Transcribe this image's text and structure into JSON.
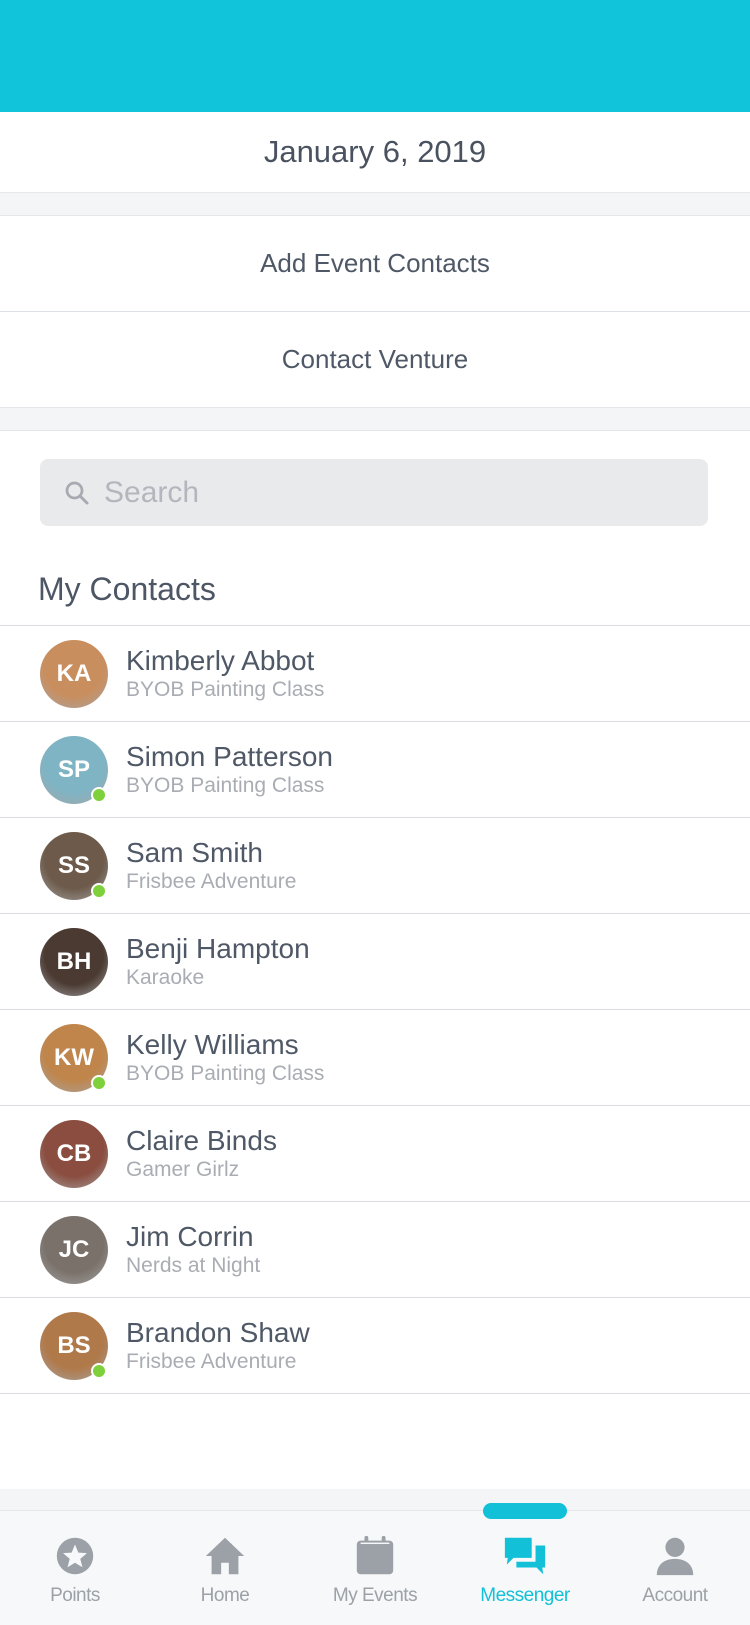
{
  "colors": {
    "brand": "#11c4da",
    "online": "#7fd13b",
    "tab_inactive": "#9ca1a8"
  },
  "header": {
    "date": "January 6, 2019"
  },
  "actions": [
    {
      "label": "Add Event Contacts"
    },
    {
      "label": "Contact Venture"
    }
  ],
  "search": {
    "placeholder": "Search",
    "value": ""
  },
  "contacts_section": {
    "title": "My Contacts"
  },
  "contacts": [
    {
      "name": "Kimberly Abbot",
      "event": "BYOB Painting Class",
      "initials": "KA",
      "online": false,
      "avatar_color": "#c98e5e"
    },
    {
      "name": "Simon Patterson",
      "event": "BYOB Painting Class",
      "initials": "SP",
      "online": true,
      "avatar_color": "#7fb4c4"
    },
    {
      "name": "Sam Smith",
      "event": "Frisbee Adventure",
      "initials": "SS",
      "online": true,
      "avatar_color": "#6d5a4a"
    },
    {
      "name": "Benji Hampton",
      "event": "Karaoke",
      "initials": "BH",
      "online": false,
      "avatar_color": "#4a3a32"
    },
    {
      "name": "Kelly Williams",
      "event": "BYOB Painting Class",
      "initials": "KW",
      "online": true,
      "avatar_color": "#c0854b"
    },
    {
      "name": "Claire Binds",
      "event": "Gamer Girlz",
      "initials": "CB",
      "online": false,
      "avatar_color": "#8a4d3f"
    },
    {
      "name": "Jim Corrin",
      "event": "Nerds at Night",
      "initials": "JC",
      "online": false,
      "avatar_color": "#7a716a"
    },
    {
      "name": "Brandon Shaw",
      "event": "Frisbee Adventure",
      "initials": "BS",
      "online": true,
      "avatar_color": "#b0794a"
    }
  ],
  "tabbar": {
    "active": "Messenger",
    "tabs": [
      {
        "label": "Points",
        "icon": "star-badge-icon"
      },
      {
        "label": "Home",
        "icon": "home-icon"
      },
      {
        "label": "My Events",
        "icon": "calendar-icon"
      },
      {
        "label": "Messenger",
        "icon": "chat-bubbles-icon"
      },
      {
        "label": "Account",
        "icon": "person-icon"
      }
    ]
  }
}
